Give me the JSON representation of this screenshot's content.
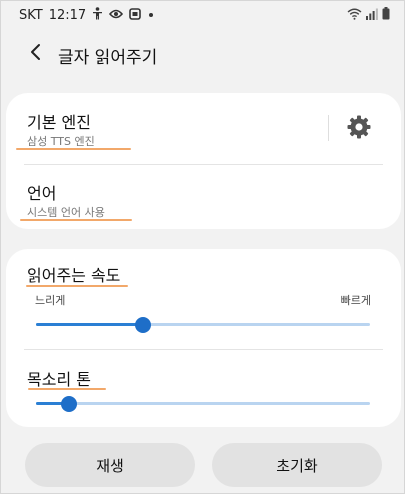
{
  "status_bar": {
    "carrier": "SKT",
    "time": "12:17",
    "icons": [
      "person-icon",
      "eye-icon",
      "screen-mirror-icon",
      "dot-icon",
      "wifi-icon",
      "signal-icon",
      "battery-icon"
    ]
  },
  "header": {
    "back_icon": "chevron-left-icon",
    "title": "글자 읽어주기"
  },
  "engine": {
    "title": "기본 엔진",
    "subtitle": "삼성 TTS 엔진",
    "settings_icon": "gear-icon"
  },
  "language": {
    "title": "언어",
    "subtitle": "시스템 언어 사용"
  },
  "speech_rate": {
    "title": "읽어주는 속도",
    "min_label": "느리게",
    "max_label": "빠르게",
    "value_percent": 32
  },
  "pitch": {
    "title": "목소리 톤",
    "value_percent": 10
  },
  "buttons": {
    "play_label": "재생",
    "reset_label": "초기화"
  },
  "colors": {
    "accent": "#1e6ec8",
    "track": "#b9d4f0",
    "highlight_underline": "#f2a86a",
    "card": "#ffffff",
    "background": "#f2f2f2"
  }
}
